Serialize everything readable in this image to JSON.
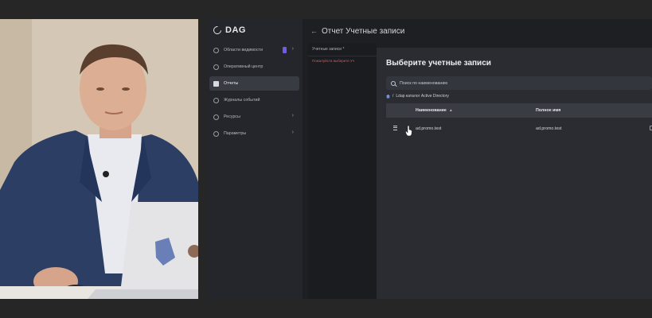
{
  "app": {
    "logo": "DAG",
    "header_title": "Отчет Учетные записи"
  },
  "sidebar": {
    "items": [
      {
        "label": "Области видимости",
        "icon": "globe-icon",
        "badge": true,
        "chevron": "›"
      },
      {
        "label": "Оперативный центр",
        "icon": "radar-icon"
      },
      {
        "label": "Отчеты",
        "icon": "chart-icon",
        "active": true
      },
      {
        "label": "Журналы событий",
        "icon": "log-icon"
      },
      {
        "label": "Ресурсы",
        "icon": "database-icon",
        "chevron": "›"
      },
      {
        "label": "Параметры",
        "icon": "gear-icon",
        "chevron": "›"
      }
    ]
  },
  "form": {
    "field_label": "Учетные записи *",
    "field_error": "Пожалуйста выберите Уч"
  },
  "modal": {
    "title": "Выберите учетные записи",
    "search_placeholder": "Поиск по наименованию",
    "breadcrumb_sep": "/",
    "breadcrumb": "Ldap каталог Active Directory",
    "columns": {
      "name": "Наименование",
      "full_name": "Полное имя",
      "sort": "▲"
    },
    "rows": [
      {
        "name": "ad.promo.test",
        "full_name": "ad.promo.test"
      }
    ]
  },
  "colors": {
    "accent": "#6b5cf0",
    "background": "#1e1f23",
    "sidebar": "#25262b",
    "modal": "#2b2c32",
    "error": "#c85c5c"
  }
}
